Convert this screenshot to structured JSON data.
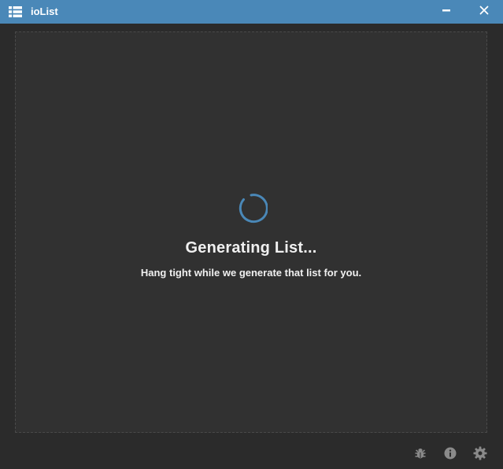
{
  "window": {
    "title": "ioList",
    "app_icon": "list-icon",
    "titlebar_color": "#4a88b8",
    "background_color": "#2b2b2b",
    "controls": [
      {
        "name": "minimize",
        "icon": "minimize-icon"
      },
      {
        "name": "close",
        "icon": "close-icon"
      }
    ]
  },
  "main": {
    "loading": {
      "spinner_icon": "spinner-icon",
      "spinner_color": "#4a88b8",
      "title": "Generating List...",
      "subtitle": "Hang tight while we generate that list for you."
    }
  },
  "footer": {
    "icons": [
      "bug-icon",
      "info-icon",
      "gear-icon"
    ],
    "icon_color": "#8a8a8a"
  }
}
